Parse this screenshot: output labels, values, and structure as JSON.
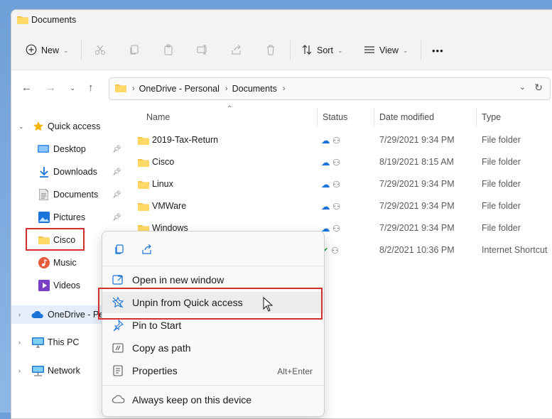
{
  "window": {
    "title": "Documents"
  },
  "toolbar": {
    "new_label": "New",
    "sort_label": "Sort",
    "view_label": "View",
    "more_label": "•••"
  },
  "address": {
    "crumbs": [
      "OneDrive - Personal",
      "Documents"
    ]
  },
  "sidebar": {
    "items": [
      {
        "label": "Quick access",
        "icon": "star-icon"
      },
      {
        "label": "Desktop",
        "icon": "desktop-icon"
      },
      {
        "label": "Downloads",
        "icon": "download-icon"
      },
      {
        "label": "Documents",
        "icon": "documents-icon"
      },
      {
        "label": "Pictures",
        "icon": "pictures-icon"
      },
      {
        "label": "Cisco",
        "icon": "folder-icon"
      },
      {
        "label": "Music",
        "icon": "music-icon"
      },
      {
        "label": "Videos",
        "icon": "videos-icon"
      },
      {
        "label": "OneDrive - Pe",
        "icon": "onedrive-icon"
      },
      {
        "label": "This PC",
        "icon": "pc-icon"
      },
      {
        "label": "Network",
        "icon": "network-icon"
      }
    ]
  },
  "columns": {
    "name": "Name",
    "status": "Status",
    "modified": "Date modified",
    "type": "Type"
  },
  "files": [
    {
      "name": "2019-Tax-Return",
      "modified": "7/29/2021 9:34 PM",
      "type": "File folder"
    },
    {
      "name": "Cisco",
      "modified": "8/19/2021 8:15 AM",
      "type": "File folder"
    },
    {
      "name": "Linux",
      "modified": "7/29/2021 9:34 PM",
      "type": "File folder"
    },
    {
      "name": "VMWare",
      "modified": "7/29/2021 9:34 PM",
      "type": "File folder"
    },
    {
      "name": "Windows",
      "modified": "7/29/2021 9:34 PM",
      "type": "File folder"
    },
    {
      "name": "",
      "modified": "8/2/2021 10:36 PM",
      "type": "Internet Shortcut"
    }
  ],
  "context_menu": {
    "items": [
      {
        "label": "Open in new window",
        "icon": "open-window-icon"
      },
      {
        "label": "Unpin from Quick access",
        "icon": "unpin-icon"
      },
      {
        "label": "Pin to Start",
        "icon": "pin-icon"
      },
      {
        "label": "Copy as path",
        "icon": "copy-path-icon"
      },
      {
        "label": "Properties",
        "icon": "properties-icon",
        "shortcut": "Alt+Enter"
      },
      {
        "label": "Always keep on this device",
        "icon": "cloud-keep-icon"
      }
    ]
  },
  "colors": {
    "accent": "#1a73d9",
    "highlight_box": "#d32f2f",
    "folder": "#f6c344"
  }
}
